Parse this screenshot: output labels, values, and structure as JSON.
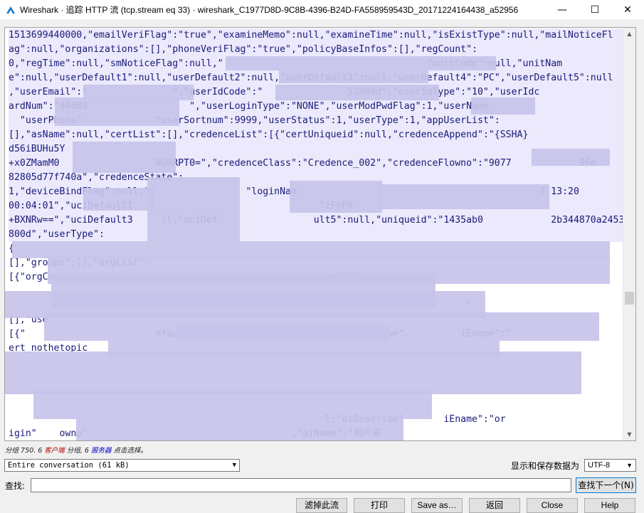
{
  "window": {
    "title": "Wireshark · 追踪 HTTP 流 (tcp.stream eq 33) · wireshark_C1977D8D-9C8B-4396-B24D-FA558959543D_20171224164438_a52956",
    "min_icon": "minimize-icon",
    "max_icon": "maximize-icon",
    "close_icon": "close-icon"
  },
  "stream_lines": [
    "1513699440000,\"emailVeriFlag\":\"true\",\"examineMemo\":null,\"examineTime\":null,\"isExistType\":null,\"mailNoticeFl",
    "ag\":null,\"organizations\":[],\"phoneVeriFlag\":\"true\",\"policyBaseInfos\":[],\"regCount\":",
    "0,\"regTime\":null,\"smNoticeFlag\":null,\"                                    \"unitCode\":null,\"unitNam",
    "e\":null,\"userDefault1\":null,\"userDefault2\":null,\"userDefault3\":null,\"userDefault4\":\"PC\",\"userDefault5\":null",
    ",\"userEmail\":\"               \",\"userIdCode\":\"               53800d\",\"userIdType\":\"10\",\"userIdc",
    "ardNum\":\"44088                  \",\"userLoginType\":\"NONE\",\"userModPwdFlag\":1,\"userName",
    "  \"userPhone\"             \"userSortnum\":9999,\"userStatus\":1,\"userType\":1,\"appUserList\":",
    "[],\"asName\":null,\"certList\":[],\"credenceList\":[{\"certUniqueid\":null,\"credenceAppend\":\"{SSHA}",
    "d56iBUHu5Y",
    "+x0ZMamM0                 NU9RPT0=\",\"credenceClass\":\"Credence_002\",\"credenceFlowno\":\"9077            96e",
    "82805d77f740a\",\"credenceState\":",
    "1,\"deviceBindFlag\":null,\"d                \"loginNam                                           7 13:20",
    "00:04:01\",\"uciDefault1                                 \"zFnPV",
    "+BXNRw==\",\"uciDefault3     ll,\"uciDef                 ult5\":null,\"uniqueid\":\"1435ab0            2b344870a2453",
    "800d\",\"userType\":",
    "{",
    "[],\"groups\":[],\"orgList\":",
    "[{\"orgCo                                               ame\":\"广",
    "",
    "                                                                                 \":",
    "[],\"use",
    "[{\"                       efault3\":null,\"aiDe           1,\"aiDescribe\"          iEname\":\"",
    "ert_nothetopic",
    "",
    "",
    "",
    "",
    "                                                        l,\"aiDescribe\"       iEname\":\"or",
    "igin\"    owno\"                                    ,\"aiName\":\"用户来",
    "源\",\"a      \"text\"",
    "0,\"aiTypeCo"
  ],
  "status": {
    "prefix": "分组 750. 6",
    "client_label": "客户端",
    "middle": "分组, 6",
    "server_label": "服务器",
    "suffix": "点击选择。"
  },
  "conversation_select": "Entire conversation (61 kB)",
  "save_label": "显示和保存数据为",
  "encoding_select": "UTF-8",
  "find": {
    "label": "查找:",
    "value": "",
    "next_button": "查找下一个(N)"
  },
  "buttons": {
    "filter_out": "滤掉此流",
    "print": "打印",
    "save_as": "Save as…",
    "back": "返回",
    "close": "Close",
    "help": "Help"
  },
  "colors": {
    "text": "#1a1a78",
    "highlight": "#ebe9fb",
    "redaction": "#c7c3ea",
    "client": "#c00000",
    "server": "#0000c0"
  },
  "scrollbar_position": 0.67
}
